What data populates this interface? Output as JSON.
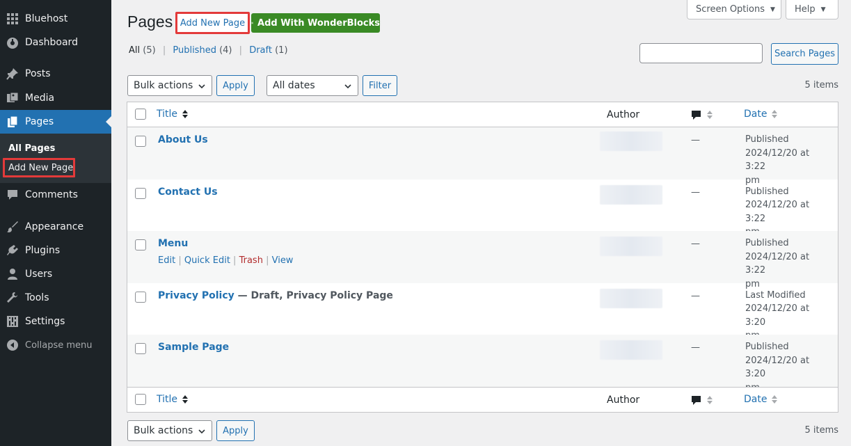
{
  "sidebar": {
    "items": [
      {
        "label": "Bluehost",
        "icon": "grid-icon"
      },
      {
        "label": "Dashboard",
        "icon": "dashboard-icon"
      },
      {
        "label": "Posts",
        "icon": "pin-icon"
      },
      {
        "label": "Media",
        "icon": "media-icon"
      },
      {
        "label": "Pages",
        "icon": "pages-icon"
      },
      {
        "label": "Comments",
        "icon": "comment-icon"
      },
      {
        "label": "Appearance",
        "icon": "brush-icon"
      },
      {
        "label": "Plugins",
        "icon": "plugin-icon"
      },
      {
        "label": "Users",
        "icon": "user-icon"
      },
      {
        "label": "Tools",
        "icon": "wrench-icon"
      },
      {
        "label": "Settings",
        "icon": "settings-icon"
      }
    ],
    "submenu": {
      "all_pages": "All Pages",
      "add_new_page": "Add New Page"
    },
    "collapse": "Collapse menu"
  },
  "header": {
    "title": "Pages",
    "add_new": "Add New Page",
    "wonderblocks": "Add With WonderBlocks",
    "screen_options": "Screen Options",
    "help": "Help"
  },
  "filters": {
    "all": "All",
    "all_count": "(5)",
    "published": "Published",
    "published_count": "(4)",
    "draft": "Draft",
    "draft_count": "(1)",
    "separator": "|"
  },
  "search": {
    "value": "",
    "button": "Search Pages"
  },
  "tablenav": {
    "bulk_actions": "Bulk actions",
    "apply": "Apply",
    "dates": "All dates",
    "filter": "Filter",
    "items_count": "5 items"
  },
  "table": {
    "columns": {
      "title": "Title",
      "author": "Author",
      "date": "Date"
    },
    "rows": [
      {
        "title": "About Us",
        "state": "",
        "comments": "—",
        "status": "Published",
        "date": "2024/12/20 at 3:22",
        "time_suffix": "pm"
      },
      {
        "title": "Contact Us",
        "state": "",
        "comments": "—",
        "status": "Published",
        "date": "2024/12/20 at 3:22",
        "time_suffix": "pm"
      },
      {
        "title": "Menu",
        "state": "",
        "comments": "—",
        "status": "Published",
        "date": "2024/12/20 at 3:22",
        "time_suffix": "pm"
      },
      {
        "title": "Privacy Policy",
        "state": " — Draft, Privacy Policy Page",
        "comments": "—",
        "status": "Last Modified",
        "date": "2024/12/20 at 3:20",
        "time_suffix": "pm"
      },
      {
        "title": "Sample Page",
        "state": "",
        "comments": "—",
        "status": "Published",
        "date": "2024/12/20 at 3:20",
        "time_suffix": "pm"
      }
    ],
    "row_actions": {
      "edit": "Edit",
      "quick_edit": "Quick Edit",
      "trash": "Trash",
      "view": "View",
      "sep": " | "
    }
  },
  "colors": {
    "sidebar_bg": "#1d2327",
    "accent": "#2271b1",
    "highlight": "#e33a3a",
    "wonder_green": "#3a8a25"
  }
}
